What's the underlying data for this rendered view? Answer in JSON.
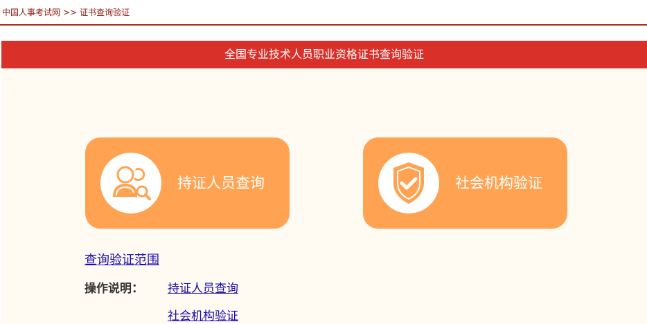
{
  "breadcrumb": {
    "home": "中国人事考试网",
    "separator": ">>",
    "current": "证书查询验证"
  },
  "panel": {
    "title": "全国专业技术人员职业资格证书查询验证"
  },
  "cards": {
    "person": {
      "label": "持证人员查询",
      "icon": "person-search-icon"
    },
    "org": {
      "label": "社会机构验证",
      "icon": "shield-check-icon"
    }
  },
  "links": {
    "scope": "查询验证范围"
  },
  "instructions": {
    "label": "操作说明：",
    "person_link": "持证人员查询",
    "org_link": "社会机构验证"
  },
  "colors": {
    "header_red": "#d9302a",
    "card_orange": "#ffa352",
    "panel_bg": "#fffaf2",
    "link_blue": "#1a0dab",
    "breadcrumb_text": "#8b1a10"
  }
}
